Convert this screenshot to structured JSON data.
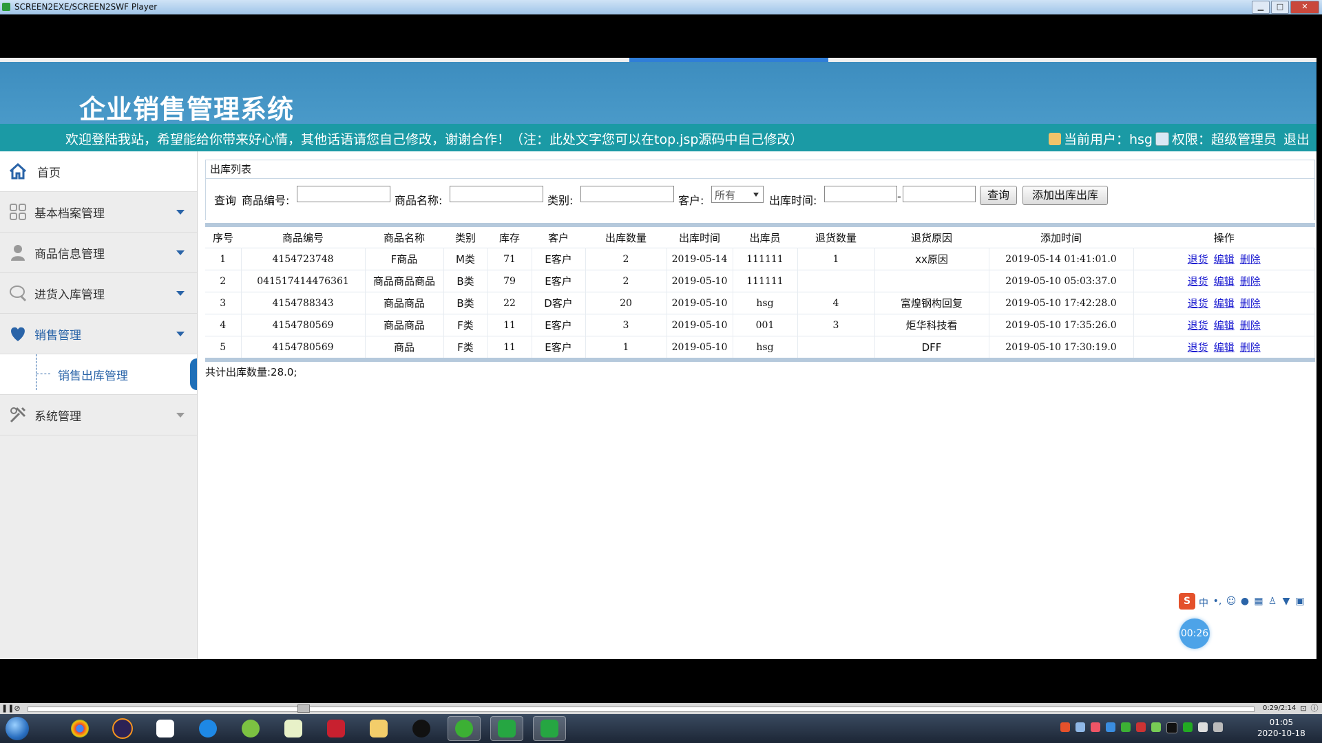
{
  "window": {
    "title": "SCREEN2EXE/SCREEN2SWF Player",
    "min": "▁",
    "max": "□",
    "close": "✕"
  },
  "app": {
    "system_title": "企业销售管理系统",
    "welcome": "欢迎登陆我站，希望能给你带来好心情，其他话语请您自己修改，谢谢合作！（注：此处文字您可以在top.jsp源码中自己修改）",
    "current_user_label": "当前用户：hsg",
    "permission_label": "权限：超级管理员",
    "logout": "退出"
  },
  "sidebar": {
    "home": "首页",
    "items": [
      {
        "label": "基本档案管理",
        "icon": "grid-icon"
      },
      {
        "label": "商品信息管理",
        "icon": "person-icon"
      },
      {
        "label": "进货入库管理",
        "icon": "chat-icon"
      },
      {
        "label": "销售管理",
        "icon": "heart-icon"
      }
    ],
    "sub_item": "销售出库管理",
    "system": "系统管理"
  },
  "panel": {
    "title": "出库列表"
  },
  "query": {
    "label": "查询",
    "code_label": "商品编号:",
    "name_label": "商品名称:",
    "category_label": "类别:",
    "customer_label": "客户:",
    "customer_value": "所有",
    "time_label": "出库时间:",
    "time_dash": "-",
    "search_button": "查询",
    "add_button": "添加出库出库"
  },
  "table": {
    "headers": [
      "序号",
      "商品编号",
      "商品名称",
      "类别",
      "库存",
      "客户",
      "出库数量",
      "出库时间",
      "出库员",
      "退货数量",
      "退货原因",
      "添加时间",
      "操作"
    ],
    "rows": [
      [
        "1",
        "4154723748",
        "F商品",
        "M类",
        "71",
        "E客户",
        "2",
        "2019-05-14",
        "111111",
        "1",
        "xx原因",
        "2019-05-14 01:41:01.0"
      ],
      [
        "2",
        "041517414476361",
        "商品商品商品",
        "B类",
        "79",
        "E客户",
        "2",
        "2019-05-10",
        "111111",
        "",
        "",
        "2019-05-10 05:03:37.0"
      ],
      [
        "3",
        "4154788343",
        "商品商品",
        "B类",
        "22",
        "D客户",
        "20",
        "2019-05-10",
        "hsg",
        "4",
        "富煌钢构回复",
        "2019-05-10 17:42:28.0"
      ],
      [
        "4",
        "4154780569",
        "商品商品",
        "F类",
        "11",
        "E客户",
        "3",
        "2019-05-10",
        "001",
        "3",
        "炬华科技看",
        "2019-05-10 17:35:26.0"
      ],
      [
        "5",
        "4154780569",
        "商品",
        "F类",
        "11",
        "E客户",
        "1",
        "2019-05-10",
        "hsg",
        "",
        "DFF",
        "2019-05-10 17:30:19.0"
      ]
    ],
    "actions": [
      "退货",
      "编辑",
      "删除"
    ]
  },
  "total_text": "共计出库数量:28.0;",
  "ime": {
    "logo": "S",
    "mode": "中",
    "punct": "•,"
  },
  "timer_badge": "00:26",
  "player": {
    "time": "0:29/2:14"
  },
  "clock": {
    "time": "01:05",
    "date": "2020-10-18"
  },
  "colors": {
    "banner": "#4a9ac9",
    "welcome_bar": "#1b9aa5",
    "link": "#1a1ad0",
    "accent": "#2a64a8"
  }
}
